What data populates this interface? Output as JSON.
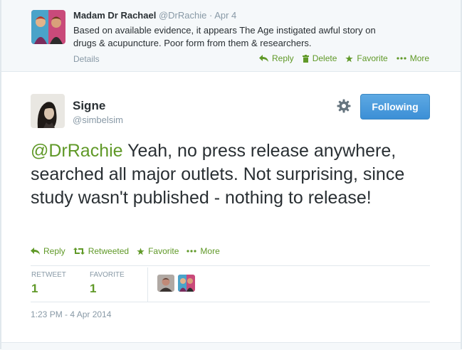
{
  "parent_tweet": {
    "fullname": "Madam Dr Rachael",
    "username": "@DrRachie",
    "separator": "·",
    "time": "Apr 4",
    "text_line1": "Based on available evidence, it appears The Age instigated awful story on",
    "text_line2": "drugs & acupuncture. Poor form from them & researchers.",
    "details_label": "Details",
    "actions": {
      "reply": "Reply",
      "delete": "Delete",
      "favorite": "Favorite",
      "more": "More"
    }
  },
  "tweet": {
    "fullname": "Signe",
    "username": "@simbelsim",
    "follow_label": "Following",
    "mention": "@DrRachie",
    "text": " Yeah, no press release anywhere, searched all major outlets. Not surprising, since study wasn't published - nothing to release!",
    "actions": {
      "reply": "Reply",
      "retweeted": "Retweeted",
      "favorite": "Favorite",
      "more": "More"
    },
    "stats": {
      "retweet_label": "RETWEET",
      "retweet_count": "1",
      "favorite_label": "FAVORITE",
      "favorite_count": "1"
    },
    "timestamp": "1:23 PM - 4 Apr 2014"
  },
  "colors": {
    "accent_green": "#609928",
    "follow_blue": "#4c9fe0",
    "muted": "#8899a6"
  }
}
